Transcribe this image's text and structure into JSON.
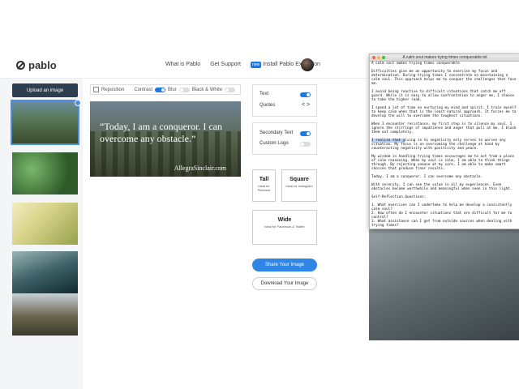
{
  "app": {
    "name": "pablo"
  },
  "nav": {
    "links": [
      "What is Pablo",
      "Get Support"
    ],
    "new_badge": "new",
    "extension": "Install Pablo Extension"
  },
  "sidebar": {
    "upload_label": "Upload an image"
  },
  "toolbar": {
    "reposition": "Reposition",
    "contrast": "Contrast",
    "blur": "Blur",
    "bw": "Black & White"
  },
  "canvas": {
    "quote": "“Today, I am a conqueror. I can overcome any obstacle.”",
    "author": "AllegraSinclair.com"
  },
  "options": {
    "text": "Text",
    "quotes": "Quotes",
    "quotes_nav": "< >",
    "secondary_text": "Secondary Text",
    "custom_logo": "Custom Logo"
  },
  "sizes": {
    "tall": {
      "title": "Tall",
      "desc": "Ideal for Pinterest"
    },
    "square": {
      "title": "Square",
      "desc": "Ideal for Instagram"
    },
    "wide": {
      "title": "Wide",
      "desc": "Ideal for Facebook & Twitter"
    }
  },
  "actions": {
    "share": "Share Your Image",
    "download": "Download Your Image"
  },
  "editor": {
    "title": "A calm soul makes trying times conquerable.txt",
    "p0": "A calm soul makes trying times conquerable.",
    "p1": "Difficulties give me an opportunity to exercise my focus and determination. During trying times I concentrate on maintaining a calm soul. This approach helps me to conquer the challenges that face me.",
    "p2": "I avoid being reactive to difficult situations that catch me off guard. While it is easy to allow confrontation to anger me, I choose to take the higher road.",
    "p3": "I spend a lot of time on nurturing my mind and spirit. I train myself to keep calm when that is the least natural approach. It forces me to develop the will to overcome the toughest situations.",
    "p4": "When I encounter resistance, my first step is to silence my soul. I ignore the stirrings of impatience and anger that pull at me. I block them out completely.",
    "p5_hl": "I realize that g",
    "p5_rest": "iving in to negativity only serves to worsen any situation. My focus is on overcoming the challenge at hand by counteracting negativity with positivity and peace.",
    "p6": "My wisdom in handling trying times encourages me to act from a place of calm reasoning. When my soul is calm, I am able to think things through. By rejecting unease at my core, I am able to make smart choices that produce finer results.",
    "p7": "Today, I am a conqueror. I can overcome any obstacle.",
    "p8": "With serenity, I can see the value in all my experiences. Even obstacles become worthwhile and meaningful when seen in this light.",
    "p9": "Self-Reflection Questions:",
    "p10": "1. What exercises can I undertake to help me develop a consistently calm soul?\n2. How often do I encounter situations that are difficult for me to control?\n3. What assistance can I get from outside sources when dealing with trying times?"
  }
}
